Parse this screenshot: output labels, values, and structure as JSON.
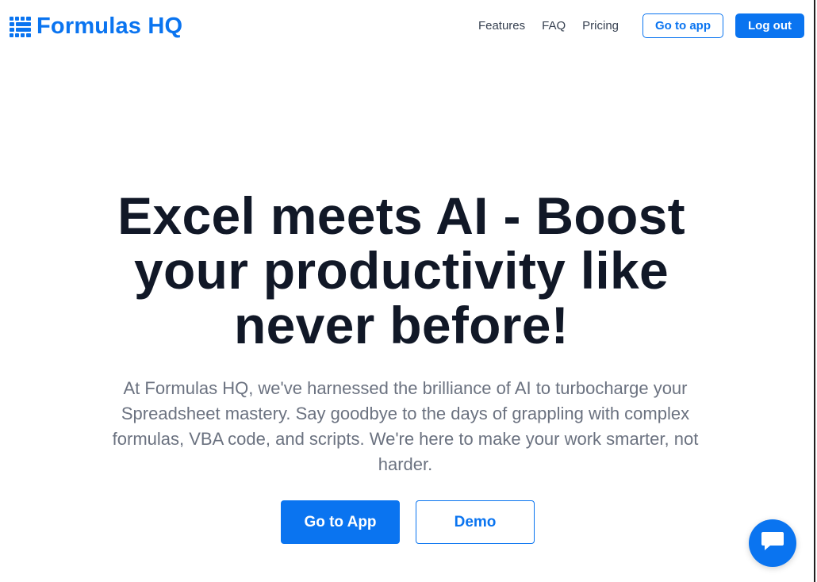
{
  "brand": {
    "name": "Formulas HQ",
    "icon": "spreadsheet-grid-icon",
    "color": "#0a74f0"
  },
  "nav": {
    "links": [
      "Features",
      "FAQ",
      "Pricing"
    ],
    "go_to_app": "Go to app",
    "log_out": "Log out"
  },
  "hero": {
    "title": "Excel meets AI - Boost your productivity like never before!",
    "subtitle": "At Formulas HQ, we've harnessed the brilliance of AI to turbocharge your Spreadsheet mastery. Say goodbye to the days of grappling with complex formulas, VBA code, and scripts. We're here to make your work smarter, not harder.",
    "primary_cta": "Go to App",
    "secondary_cta": "Demo"
  },
  "chat": {
    "icon": "chat-bubble-icon"
  },
  "colors": {
    "accent": "#0a74f0",
    "heading": "#111827",
    "body_text": "#6b7280",
    "nav_text": "#374151"
  }
}
